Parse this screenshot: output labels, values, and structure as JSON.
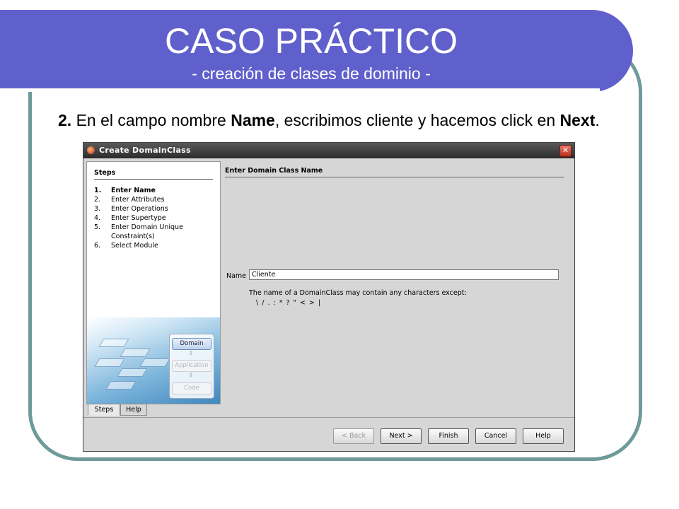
{
  "slide": {
    "title": "CASO PRÁCTICO",
    "subtitle": "- creación de clases de dominio -",
    "instruction": {
      "step_num": "2.",
      "part1": " En el campo nombre ",
      "bold1": "Name",
      "part2": ", escribimos cliente y hacemos click en ",
      "bold2": "Next",
      "part3": "."
    }
  },
  "dialog": {
    "title": "Create DomainClass",
    "close_glyph": "✕",
    "steps_header": "Steps",
    "steps": [
      {
        "num": "1.",
        "label": "Enter Name"
      },
      {
        "num": "2.",
        "label": "Enter Attributes"
      },
      {
        "num": "3.",
        "label": "Enter Operations"
      },
      {
        "num": "4.",
        "label": "Enter Supertype"
      },
      {
        "num": "5.",
        "label": "Enter Domain Unique"
      },
      {
        "num": "",
        "label": "Constraint(s)"
      },
      {
        "num": "6.",
        "label": "Select Module"
      }
    ],
    "layers": [
      "Domain",
      "Application",
      "Code"
    ],
    "layer_arrow": "⇕",
    "tabs": [
      "Steps",
      "Help"
    ],
    "section_title": "Enter Domain Class Name",
    "name_label": "Name",
    "name_value": "Cliente",
    "help_text": "The name of a DomainClass may contain any characters except:",
    "forbidden_chars": "\\ / . : * ? \" < > |",
    "buttons": {
      "back": "< Back",
      "next": "Next >",
      "finish": "Finish",
      "cancel": "Cancel",
      "help": "Help"
    }
  }
}
